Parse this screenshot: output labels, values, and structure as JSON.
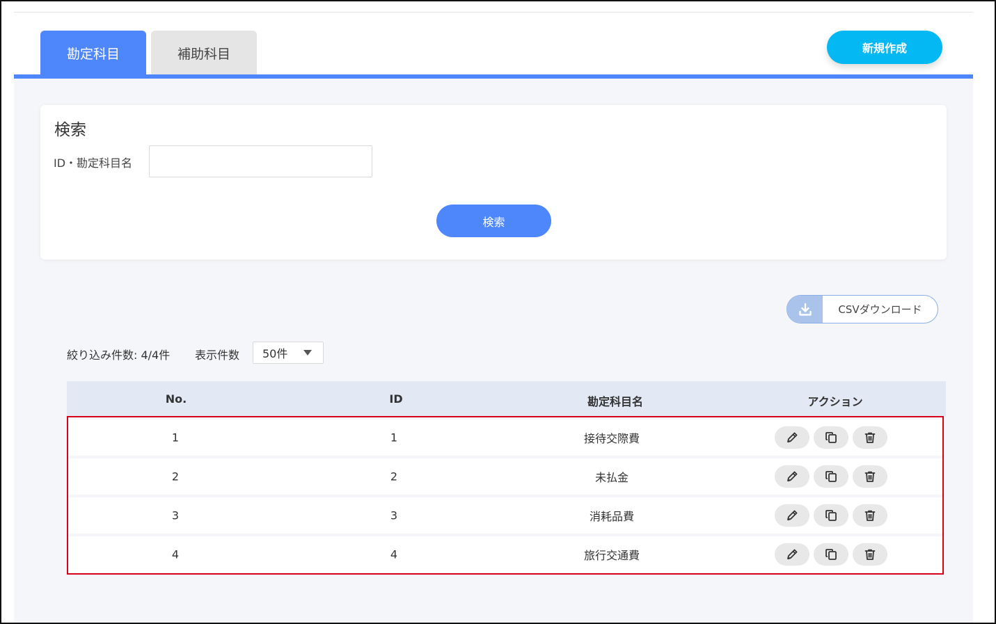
{
  "tabs": [
    {
      "label": "勘定科目",
      "active": true
    },
    {
      "label": "補助科目",
      "active": false
    }
  ],
  "new_button_label": "新規作成",
  "search": {
    "title": "検索",
    "field_label": "ID・勘定科目名",
    "input_value": "",
    "button_label": "検索"
  },
  "csv": {
    "label": "CSVダウンロード",
    "icon": "download-icon"
  },
  "list_controls": {
    "filter_count_text": "絞り込み件数: 4/4件",
    "display_count_label": "表示件数",
    "display_count_value": "50件"
  },
  "table": {
    "columns": [
      "No.",
      "ID",
      "勘定科目名",
      "アクション"
    ],
    "rows": [
      {
        "no": "1",
        "id": "1",
        "name": "接待交際費"
      },
      {
        "no": "2",
        "id": "2",
        "name": "未払金"
      },
      {
        "no": "3",
        "id": "3",
        "name": "消耗品費"
      },
      {
        "no": "4",
        "id": "4",
        "name": "旅行交通費"
      }
    ],
    "actions": [
      "edit-icon",
      "copy-icon",
      "trash-icon"
    ]
  },
  "colors": {
    "primary": "#4d87fb",
    "new_button": "#03b8f3",
    "highlight_border": "#d9001b",
    "table_header": "#e3e8f5"
  }
}
